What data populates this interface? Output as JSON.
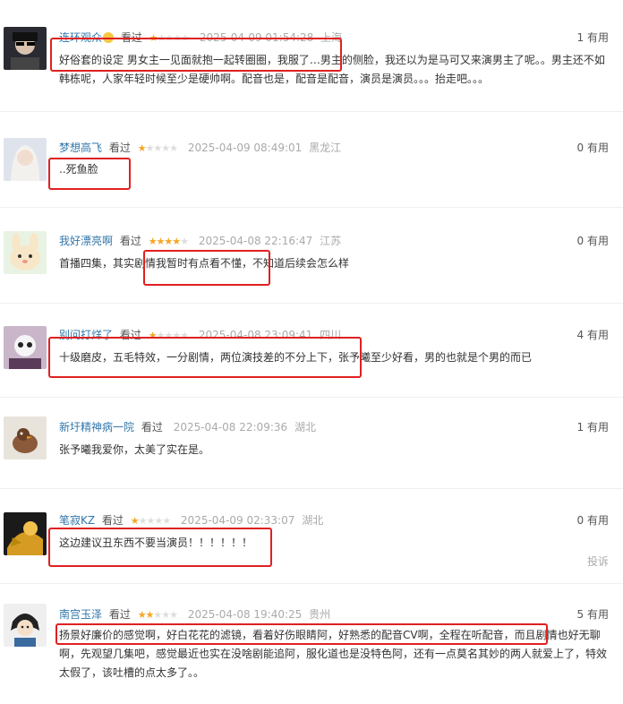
{
  "reviews": [
    {
      "user": "连环观众",
      "watched": "看过",
      "stars": 1,
      "time": "2025-04-09 01:54:28",
      "location": "上海",
      "useful": "1 有用",
      "content": "好俗套的设定 男女主一见面就抱一起转圈圈，我服了…男主的侧脸，我还以为是马可又来演男主了呢。。男主还不如韩栋呢，人家年轻时候至少是硬帅啊。配音也是，配音是配音，演员是演员。。。抬走吧。。。"
    },
    {
      "user": "梦想高飞",
      "watched": "看过",
      "stars": 1,
      "time": "2025-04-09 08:49:01",
      "location": "黑龙江",
      "useful": "0 有用",
      "content": "..死鱼脸"
    },
    {
      "user": "我好漂亮啊",
      "watched": "看过",
      "stars": 4,
      "time": "2025-04-08 22:16:47",
      "location": "江苏",
      "useful": "0 有用",
      "content": "首播四集，其实剧情我暂时有点看不懂，不知道后续会怎么样"
    },
    {
      "user": "别问打烊了",
      "watched": "看过",
      "stars": 1,
      "time": "2025-04-08 23:09:41",
      "location": "四川",
      "useful": "4 有用",
      "content": "十级磨皮，五毛特效，一分剧情，两位演技差的不分上下，张予曦至少好看，男的也就是个男的而已"
    },
    {
      "user": "新圩精神病一院",
      "watched": "看过",
      "stars": 0,
      "time": "2025-04-08 22:09:36",
      "location": "湖北",
      "useful": "1 有用",
      "content": "张予曦我爱你，太美了实在是。"
    },
    {
      "user": "笔寂KZ",
      "watched": "看过",
      "stars": 1,
      "time": "2025-04-09 02:33:07",
      "location": "湖北",
      "useful": "0 有用",
      "content": "这边建议丑东西不要当演员！！！！！！",
      "report": "投诉"
    },
    {
      "user": "南宫玉泽",
      "watched": "看过",
      "stars": 2,
      "time": "2025-04-08 19:40:25",
      "location": "贵州",
      "useful": "5 有用",
      "content": "扬景好廉价的感觉啊，好白花花的滤镜，看着好伤眼睛阿，好熟悉的配音CV啊，全程在听配音，而且剧情也好无聊啊，先观望几集吧，感觉最近也实在没啥剧能追阿，服化道也是没特色阿，还有一点莫名其妙的两人就爱上了，特效太假了，该吐槽的点太多了。。"
    }
  ],
  "colors": {
    "link": "#3377aa",
    "star": "#f5a623",
    "highlight": "#e02020"
  }
}
